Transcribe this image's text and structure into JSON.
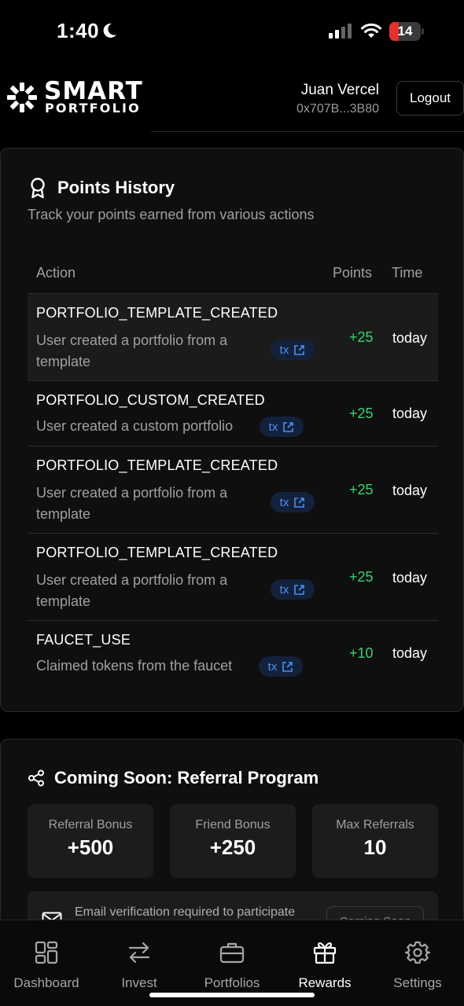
{
  "status_bar": {
    "time": "1:40",
    "battery": "14",
    "battery_level": 0.14
  },
  "header": {
    "logo_line1": "SMART",
    "logo_line2": "PORTFOLIO",
    "user_name": "Juan Vercel",
    "wallet": "0x707B...3B80",
    "logout_label": "Logout"
  },
  "points_history": {
    "title": "Points History",
    "subtitle": "Track your points earned from various actions",
    "columns": {
      "action": "Action",
      "points": "Points",
      "time": "Time"
    },
    "rows": [
      {
        "action": "PORTFOLIO_TEMPLATE_CREATED",
        "description": "User created a portfolio from a template",
        "tx": "tx",
        "points": "+25",
        "time": "today"
      },
      {
        "action": "PORTFOLIO_CUSTOM_CREATED",
        "description": "User created a custom portfolio",
        "tx": "tx",
        "points": "+25",
        "time": "today"
      },
      {
        "action": "PORTFOLIO_TEMPLATE_CREATED",
        "description": "User created a portfolio from a template",
        "tx": "tx",
        "points": "+25",
        "time": "today"
      },
      {
        "action": "PORTFOLIO_TEMPLATE_CREATED",
        "description": "User created a portfolio from a template",
        "tx": "tx",
        "points": "+25",
        "time": "today"
      },
      {
        "action": "FAUCET_USE",
        "description": "Claimed tokens from the faucet",
        "tx": "tx",
        "points": "+10",
        "time": "today"
      }
    ]
  },
  "referral": {
    "title": "Coming Soon: Referral Program",
    "stats": [
      {
        "label": "Referral Bonus",
        "value": "+500"
      },
      {
        "label": "Friend Bonus",
        "value": "+250"
      },
      {
        "label": "Max Referrals",
        "value": "10"
      }
    ],
    "email_notice": "Email verification required to participate",
    "coming_soon_label": "Coming Soon"
  },
  "tabs": [
    {
      "label": "Dashboard",
      "icon": "dashboard-icon",
      "active": false
    },
    {
      "label": "Invest",
      "icon": "swap-arrows-icon",
      "active": false
    },
    {
      "label": "Portfolios",
      "icon": "briefcase-icon",
      "active": false
    },
    {
      "label": "Rewards",
      "icon": "gift-icon",
      "active": true
    },
    {
      "label": "Settings",
      "icon": "gear-icon",
      "active": false
    }
  ],
  "colors": {
    "positive": "#3ecf6d",
    "link": "#4c8ff0",
    "badge_bg": "#13213b",
    "battery_low": "#e5302e"
  }
}
